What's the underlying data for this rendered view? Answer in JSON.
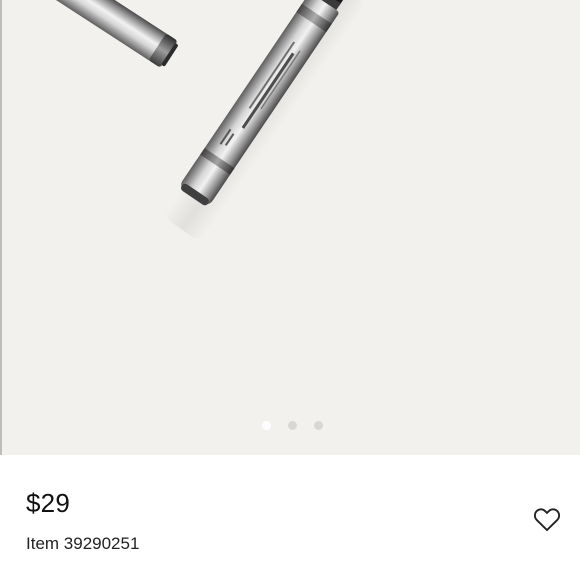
{
  "product": {
    "price": "$29",
    "item_number": "Item 39290251"
  },
  "gallery": {
    "slide_count": 3,
    "active_slide": 1,
    "background": "#f3f1ee"
  },
  "icons": {
    "favorite": "heart-outline-icon"
  }
}
